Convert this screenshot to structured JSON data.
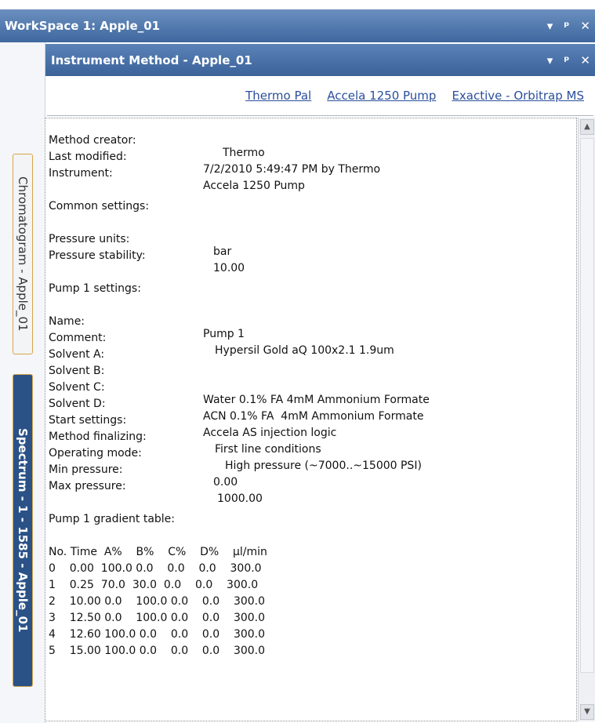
{
  "workspace": {
    "title": "WorkSpace 1: Apple_01",
    "controls": [
      "▾",
      "ᵖ",
      "✕"
    ]
  },
  "side_tabs": [
    {
      "label": "Chromatogram - Apple_01"
    },
    {
      "label": "Spectrum - 1 - 1585 - Apple_01"
    }
  ],
  "method_window": {
    "title": "Instrument Method - Apple_01",
    "controls": [
      "▾",
      "ᵖ",
      "✕"
    ]
  },
  "links": [
    "Thermo Pal",
    "Accela 1250 Pump",
    "Exactive - Orbitrap MS"
  ],
  "method": {
    "creator_label": "Method creator:",
    "creator": "Thermo",
    "modified_label": "Last modified:",
    "modified": "7/2/2010 5:49:47 PM by Thermo",
    "instrument_label": "Instrument:",
    "instrument": "Accela 1250 Pump",
    "common_heading": "Common settings:",
    "pressure_units_label": "Pressure units:",
    "pressure_units": "bar",
    "pressure_stability_label": "Pressure stability:",
    "pressure_stability": "10.00",
    "pump_heading": "Pump 1 settings:",
    "name_label": "Name:",
    "name": "Pump 1",
    "comment_label": "Comment:",
    "comment": "Hypersil Gold aQ 100x2.1 1.9um",
    "solvent_a_label": "Solvent A:",
    "solvent_b_label": "Solvent B:",
    "solvent_c_label": "Solvent C:",
    "solvent_c": "Water 0.1% FA 4mM Ammonium Formate",
    "solvent_d_label": "Solvent D:",
    "solvent_d": "ACN 0.1% FA  4mM Ammonium Formate",
    "start_label": "Start settings:",
    "start": "Accela AS injection logic",
    "finalizing_label": "Method finalizing:",
    "finalizing": "First line conditions",
    "mode_label": "Operating mode:",
    "mode": "High pressure (~7000..~15000 PSI)",
    "min_label": "Min pressure:",
    "min": "0.00",
    "max_label": "Max pressure:",
    "max": "1000.00",
    "gradient_heading": "Pump 1 gradient table:",
    "gradient_header": "No. Time  A%    B%    C%    D%    µl/min",
    "gradient_rows": [
      "0    0.00  100.0 0.0    0.0    0.0    300.0",
      "1    0.25  70.0  30.0  0.0    0.0    300.0",
      "2    10.00 0.0    100.0 0.0    0.0    300.0",
      "3    12.50 0.0    100.0 0.0    0.0    300.0",
      "4    12.60 100.0 0.0    0.0    0.0    300.0",
      "5    15.00 100.0 0.0    0.0    0.0    300.0"
    ]
  }
}
